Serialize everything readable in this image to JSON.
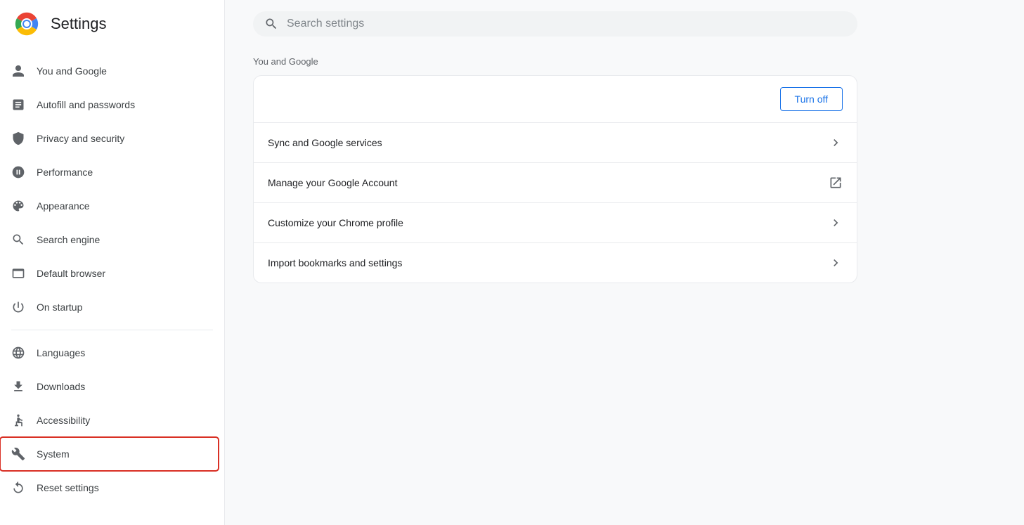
{
  "app": {
    "title": "Settings"
  },
  "search": {
    "placeholder": "Search settings"
  },
  "sidebar": {
    "items": [
      {
        "id": "you-and-google",
        "label": "You and Google",
        "icon": "person"
      },
      {
        "id": "autofill-and-passwords",
        "label": "Autofill and passwords",
        "icon": "autofill"
      },
      {
        "id": "privacy-and-security",
        "label": "Privacy and security",
        "icon": "shield"
      },
      {
        "id": "performance",
        "label": "Performance",
        "icon": "performance"
      },
      {
        "id": "appearance",
        "label": "Appearance",
        "icon": "palette"
      },
      {
        "id": "search-engine",
        "label": "Search engine",
        "icon": "search"
      },
      {
        "id": "default-browser",
        "label": "Default browser",
        "icon": "browser"
      },
      {
        "id": "on-startup",
        "label": "On startup",
        "icon": "power"
      },
      {
        "id": "languages",
        "label": "Languages",
        "icon": "globe"
      },
      {
        "id": "downloads",
        "label": "Downloads",
        "icon": "download"
      },
      {
        "id": "accessibility",
        "label": "Accessibility",
        "icon": "accessibility"
      },
      {
        "id": "system",
        "label": "System",
        "icon": "wrench",
        "highlighted": true
      },
      {
        "id": "reset-settings",
        "label": "Reset settings",
        "icon": "reset"
      }
    ]
  },
  "main": {
    "section_label": "You and Google",
    "card": {
      "turn_off_label": "Turn off",
      "rows": [
        {
          "label": "Sync and Google services",
          "has_external": false
        },
        {
          "label": "Manage your Google Account",
          "has_external": true
        },
        {
          "label": "Customize your Chrome profile",
          "has_external": false
        },
        {
          "label": "Import bookmarks and settings",
          "has_external": false
        }
      ]
    }
  }
}
